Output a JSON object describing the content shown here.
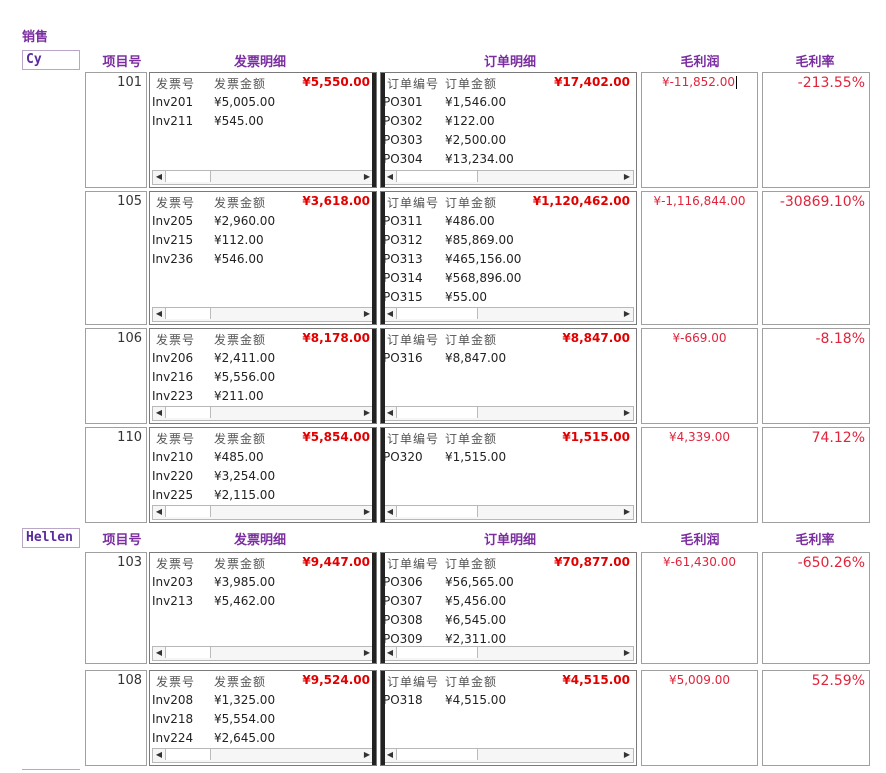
{
  "report_title": "销售",
  "headers": {
    "project_no": "项目号",
    "invoice_detail": "发票明细",
    "order_detail": "订单明细",
    "gross_profit": "毛利润",
    "gross_margin": "毛利率"
  },
  "subform_headers": {
    "invoice_no": "发票号",
    "invoice_amount": "发票金额",
    "order_no": "订单编号",
    "order_amount": "订单金额"
  },
  "groups": [
    {
      "salesperson": "Cy",
      "projects": [
        {
          "project_no": "101",
          "invoice_total": "¥5,550.00",
          "invoices": [
            {
              "no": "Inv201",
              "amount": "¥5,005.00"
            },
            {
              "no": "Inv211",
              "amount": "¥545.00"
            }
          ],
          "order_total": "¥17,402.00",
          "orders": [
            {
              "no": "PO301",
              "amount": "¥1,546.00"
            },
            {
              "no": "PO302",
              "amount": "¥122.00"
            },
            {
              "no": "PO303",
              "amount": "¥2,500.00"
            },
            {
              "no": "PO304",
              "amount": "¥13,234.00"
            }
          ],
          "gross_profit": "¥-11,852.00",
          "gross_margin": "-213.55%"
        },
        {
          "project_no": "105",
          "invoice_total": "¥3,618.00",
          "invoices": [
            {
              "no": "Inv205",
              "amount": "¥2,960.00"
            },
            {
              "no": "Inv215",
              "amount": "¥112.00"
            },
            {
              "no": "Inv236",
              "amount": "¥546.00"
            }
          ],
          "order_total": "¥1,120,462.00",
          "orders": [
            {
              "no": "PO311",
              "amount": "¥486.00"
            },
            {
              "no": "PO312",
              "amount": "¥85,869.00"
            },
            {
              "no": "PO313",
              "amount": "¥465,156.00"
            },
            {
              "no": "PO314",
              "amount": "¥568,896.00"
            },
            {
              "no": "PO315",
              "amount": "¥55.00"
            }
          ],
          "gross_profit": "¥-1,116,844.00",
          "gross_margin": "-30869.10%"
        },
        {
          "project_no": "106",
          "invoice_total": "¥8,178.00",
          "invoices": [
            {
              "no": "Inv206",
              "amount": "¥2,411.00"
            },
            {
              "no": "Inv216",
              "amount": "¥5,556.00"
            },
            {
              "no": "Inv223",
              "amount": "¥211.00"
            }
          ],
          "order_total": "¥8,847.00",
          "orders": [
            {
              "no": "PO316",
              "amount": "¥8,847.00"
            }
          ],
          "gross_profit": "¥-669.00",
          "gross_margin": "-8.18%"
        },
        {
          "project_no": "110",
          "invoice_total": "¥5,854.00",
          "invoices": [
            {
              "no": "Inv210",
              "amount": "¥485.00"
            },
            {
              "no": "Inv220",
              "amount": "¥3,254.00"
            },
            {
              "no": "Inv225",
              "amount": "¥2,115.00"
            }
          ],
          "order_total": "¥1,515.00",
          "orders": [
            {
              "no": "PO320",
              "amount": "¥1,515.00"
            }
          ],
          "gross_profit": "¥4,339.00",
          "gross_margin": "74.12%"
        }
      ]
    },
    {
      "salesperson": "Hellen",
      "projects": [
        {
          "project_no": "103",
          "invoice_total": "¥9,447.00",
          "invoices": [
            {
              "no": "Inv203",
              "amount": "¥3,985.00"
            },
            {
              "no": "Inv213",
              "amount": "¥5,462.00"
            }
          ],
          "order_total": "¥70,877.00",
          "orders": [
            {
              "no": "PO306",
              "amount": "¥56,565.00"
            },
            {
              "no": "PO307",
              "amount": "¥5,456.00"
            },
            {
              "no": "PO308",
              "amount": "¥6,545.00"
            },
            {
              "no": "PO309",
              "amount": "¥2,311.00"
            }
          ],
          "gross_profit": "¥-61,430.00",
          "gross_margin": "-650.26%"
        },
        {
          "project_no": "108",
          "invoice_total": "¥9,524.00",
          "invoices": [
            {
              "no": "Inv208",
              "amount": "¥1,325.00"
            },
            {
              "no": "Inv218",
              "amount": "¥5,554.00"
            },
            {
              "no": "Inv224",
              "amount": "¥2,645.00"
            }
          ],
          "order_total": "¥4,515.00",
          "orders": [
            {
              "no": "PO318",
              "amount": "¥4,515.00"
            }
          ],
          "gross_profit": "¥5,009.00",
          "gross_margin": "52.59%"
        }
      ]
    }
  ]
}
